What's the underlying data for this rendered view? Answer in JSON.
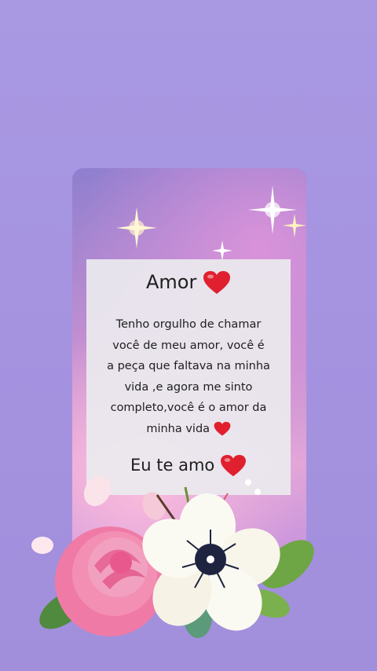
{
  "card": {
    "title": "Amor",
    "lines": [
      "Tenho orgulho de chamar",
      "você de meu amor, você é",
      "a peça que faltava na minha",
      "vida ,e agora me sinto",
      "completo,você é o amor da",
      "minha vida"
    ],
    "closing": "Eu te amo"
  },
  "colors": {
    "background": "#a998e2",
    "heart": "#e0202e",
    "card": "#ebe9ee"
  },
  "icons": [
    "heart-icon",
    "sparkle-icon",
    "rose-icon",
    "white-flower-icon",
    "leaf-icon"
  ]
}
